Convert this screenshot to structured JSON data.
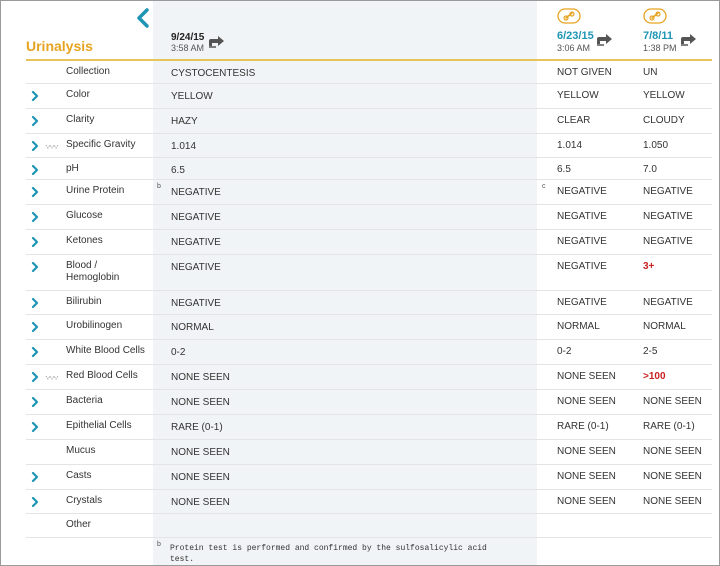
{
  "panel": {
    "title": "Urinalysis"
  },
  "columns": {
    "current": {
      "date": "9/24/15",
      "time": "3:58 AM"
    },
    "prior1": {
      "date": "6/23/15",
      "time": "3:06 AM"
    },
    "prior2": {
      "date": "7/8/11",
      "time": "1:38 PM"
    }
  },
  "rows": [
    {
      "label": "Collection",
      "expandable": false,
      "trend": false,
      "current": "CYSTOCENTESIS",
      "prior1": "NOT GIVEN",
      "prior2": "UN"
    },
    {
      "label": "Color",
      "expandable": true,
      "trend": false,
      "current": "YELLOW",
      "prior1": "YELLOW",
      "prior2": "YELLOW"
    },
    {
      "label": "Clarity",
      "expandable": true,
      "trend": false,
      "current": "HAZY",
      "prior1": "CLEAR",
      "prior2": "CLOUDY"
    },
    {
      "label": "Specific Gravity",
      "expandable": true,
      "trend": true,
      "current": "1.014",
      "prior1": "1.014",
      "prior2": "1.050"
    },
    {
      "label": "pH",
      "expandable": true,
      "trend": false,
      "current": "6.5",
      "prior1": "6.5",
      "prior2": "7.0"
    },
    {
      "label": "Urine Protein",
      "expandable": true,
      "trend": false,
      "current": "NEGATIVE",
      "prior1": "NEGATIVE",
      "prior2": "NEGATIVE",
      "current_note": "b",
      "prior1_note": "c"
    },
    {
      "label": "Glucose",
      "expandable": true,
      "trend": false,
      "current": "NEGATIVE",
      "prior1": "NEGATIVE",
      "prior2": "NEGATIVE"
    },
    {
      "label": "Ketones",
      "expandable": true,
      "trend": false,
      "current": "NEGATIVE",
      "prior1": "NEGATIVE",
      "prior2": "NEGATIVE"
    },
    {
      "label": "Blood /",
      "label2": "Hemoglobin",
      "expandable": true,
      "trend": false,
      "current": "NEGATIVE",
      "prior1": "NEGATIVE",
      "prior2": "3+",
      "prior2_abnormal": true
    },
    {
      "label": "Bilirubin",
      "expandable": true,
      "trend": false,
      "current": "NEGATIVE",
      "prior1": "NEGATIVE",
      "prior2": "NEGATIVE"
    },
    {
      "label": "Urobilinogen",
      "expandable": true,
      "trend": false,
      "current": "NORMAL",
      "prior1": "NORMAL",
      "prior2": "NORMAL"
    },
    {
      "label": "White Blood Cells",
      "expandable": true,
      "trend": false,
      "current": "0-2",
      "prior1": "0-2",
      "prior2": "2-5"
    },
    {
      "label": "Red Blood Cells",
      "expandable": true,
      "trend": true,
      "current": "NONE SEEN",
      "prior1": "NONE SEEN",
      "prior2": ">100",
      "prior2_abnormal": true
    },
    {
      "label": "Bacteria",
      "expandable": true,
      "trend": false,
      "current": "NONE SEEN",
      "prior1": "NONE SEEN",
      "prior2": "NONE SEEN"
    },
    {
      "label": "Epithelial Cells",
      "expandable": true,
      "trend": false,
      "current": "RARE (0-1)",
      "prior1": "RARE (0-1)",
      "prior2": "RARE (0-1)"
    },
    {
      "label": "Mucus",
      "expandable": false,
      "trend": false,
      "current": "NONE SEEN",
      "prior1": "NONE SEEN",
      "prior2": "NONE SEEN"
    },
    {
      "label": "Casts",
      "expandable": true,
      "trend": false,
      "current": "NONE SEEN",
      "prior1": "NONE SEEN",
      "prior2": "NONE SEEN"
    },
    {
      "label": "Crystals",
      "expandable": true,
      "trend": false,
      "current": "NONE SEEN",
      "prior1": "NONE SEEN",
      "prior2": "NONE SEEN"
    },
    {
      "label": "Other",
      "expandable": false,
      "trend": false,
      "current": "",
      "prior1": "",
      "prior2": ""
    }
  ],
  "footnote": {
    "mark": "b",
    "text": "Protein test is performed and confirmed by the sulfosalicylic acid test."
  },
  "colors": {
    "accent": "#e7a422",
    "link": "#1e95b5",
    "chevron": "#1e95b5",
    "abnormal": "#c81f1f"
  },
  "icons": {
    "back": "chevron-left-icon",
    "location": "location-arrow-icon",
    "link": "link-icon",
    "expand": "chevron-right-icon",
    "trend": "trend-icon"
  }
}
